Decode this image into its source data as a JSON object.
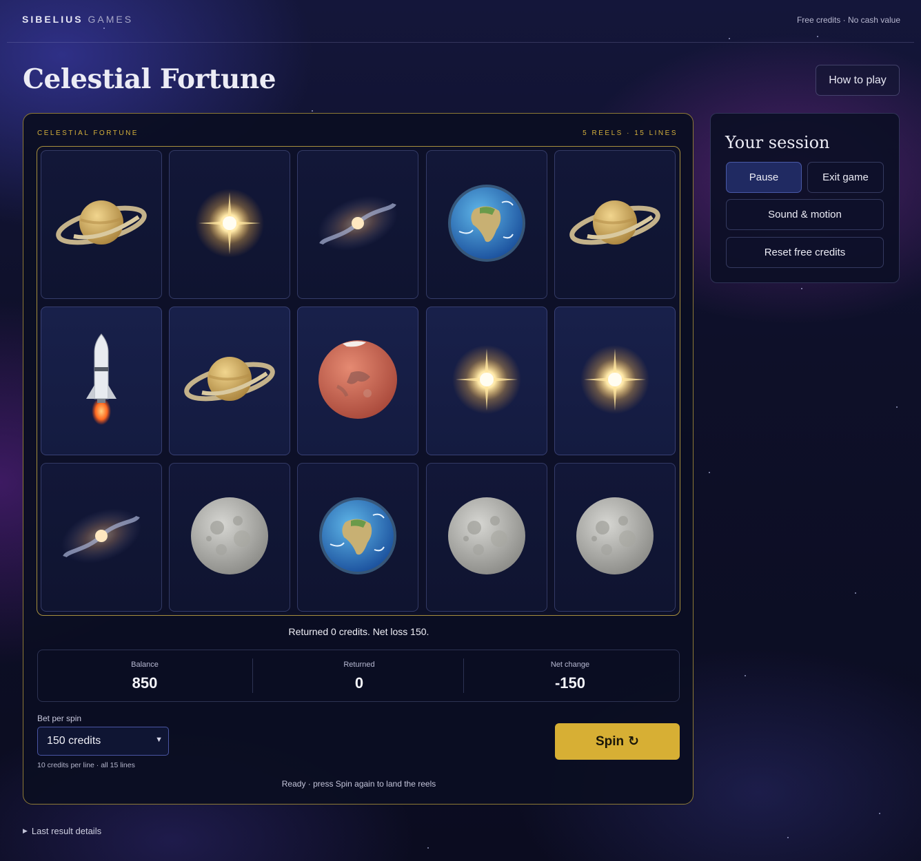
{
  "header": {
    "brand_primary": "SIBELIUS",
    "brand_secondary": "GAMES",
    "note": "Free credits · No cash value"
  },
  "page_title": "Celestial Fortune",
  "how_to_play_label": "How to play",
  "machine": {
    "label_left": "CELESTIAL FORTUNE",
    "label_right": "5 REELS · 15 LINES",
    "grid": [
      [
        "saturn",
        "star",
        "galaxy",
        "earth",
        "saturn"
      ],
      [
        "rocket",
        "saturn",
        "mars",
        "star",
        "star"
      ],
      [
        "galaxy",
        "moon",
        "earth",
        "moon",
        "moon"
      ]
    ],
    "highlighted_row": 1,
    "result_message": "Returned 0 credits. Net loss 150.",
    "stats": [
      {
        "label": "Balance",
        "value": "850"
      },
      {
        "label": "Returned",
        "value": "0"
      },
      {
        "label": "Net change",
        "value": "-150"
      }
    ],
    "bet": {
      "label": "Bet per spin",
      "selected": "150 credits",
      "note": "10 credits per line · all 15 lines"
    },
    "spin_label": "Spin",
    "spin_icon": "↻",
    "status_message": "Ready · press Spin again to land the reels"
  },
  "session": {
    "title": "Your session",
    "pause_label": "Pause",
    "exit_label": "Exit game",
    "sound_label": "Sound & motion",
    "reset_label": "Reset free credits"
  },
  "details_label": "Last result details",
  "colors": {
    "accent_gold": "#d7af34",
    "background": "#0e1029"
  }
}
